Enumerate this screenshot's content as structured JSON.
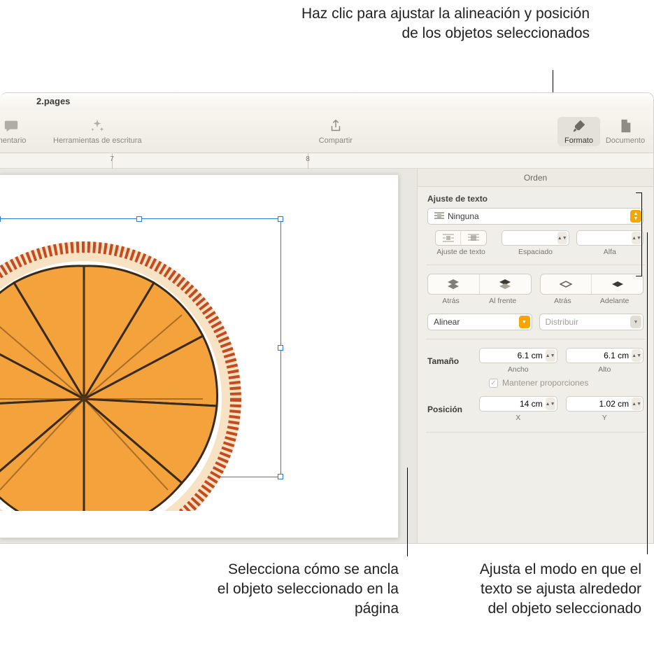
{
  "annotations": {
    "top": "Haz clic para ajustar la alineación y posición de los objetos seleccionados",
    "bottom_left": "Selecciona cómo se ancla el objeto seleccionado en la página",
    "bottom_right": "Ajusta el modo en que el texto se ajusta alrededor del objeto seleccionado"
  },
  "window": {
    "title": "2.pages"
  },
  "toolbar": {
    "comentario": "mentario",
    "herramientas": "Herramientas de escritura",
    "compartir": "Compartir",
    "formato": "Formato",
    "documento": "Documento"
  },
  "ruler": {
    "t7": "7",
    "t8": "8"
  },
  "inspector": {
    "tab_orden": "Orden",
    "ajuste_label": "Ajuste de texto",
    "ajuste_value": "Ninguna",
    "ajuste_cap": "Ajuste de texto",
    "espaciado_cap": "Espaciado",
    "alfa_cap": "Alfa",
    "atras": "Atrás",
    "alfrente": "Al frente",
    "atras2": "Atrás",
    "adelante": "Adelante",
    "alinear": "Alinear",
    "distribuir": "Distribuir",
    "tamano": "Tamaño",
    "ancho_val": "6.1 cm",
    "alto_val": "6.1 cm",
    "ancho_cap": "Ancho",
    "alto_cap": "Alto",
    "mantener": "Mantener proporciones",
    "posicion": "Posición",
    "x_val": "14 cm",
    "y_val": "1.02 cm",
    "x_cap": "X",
    "y_cap": "Y"
  }
}
